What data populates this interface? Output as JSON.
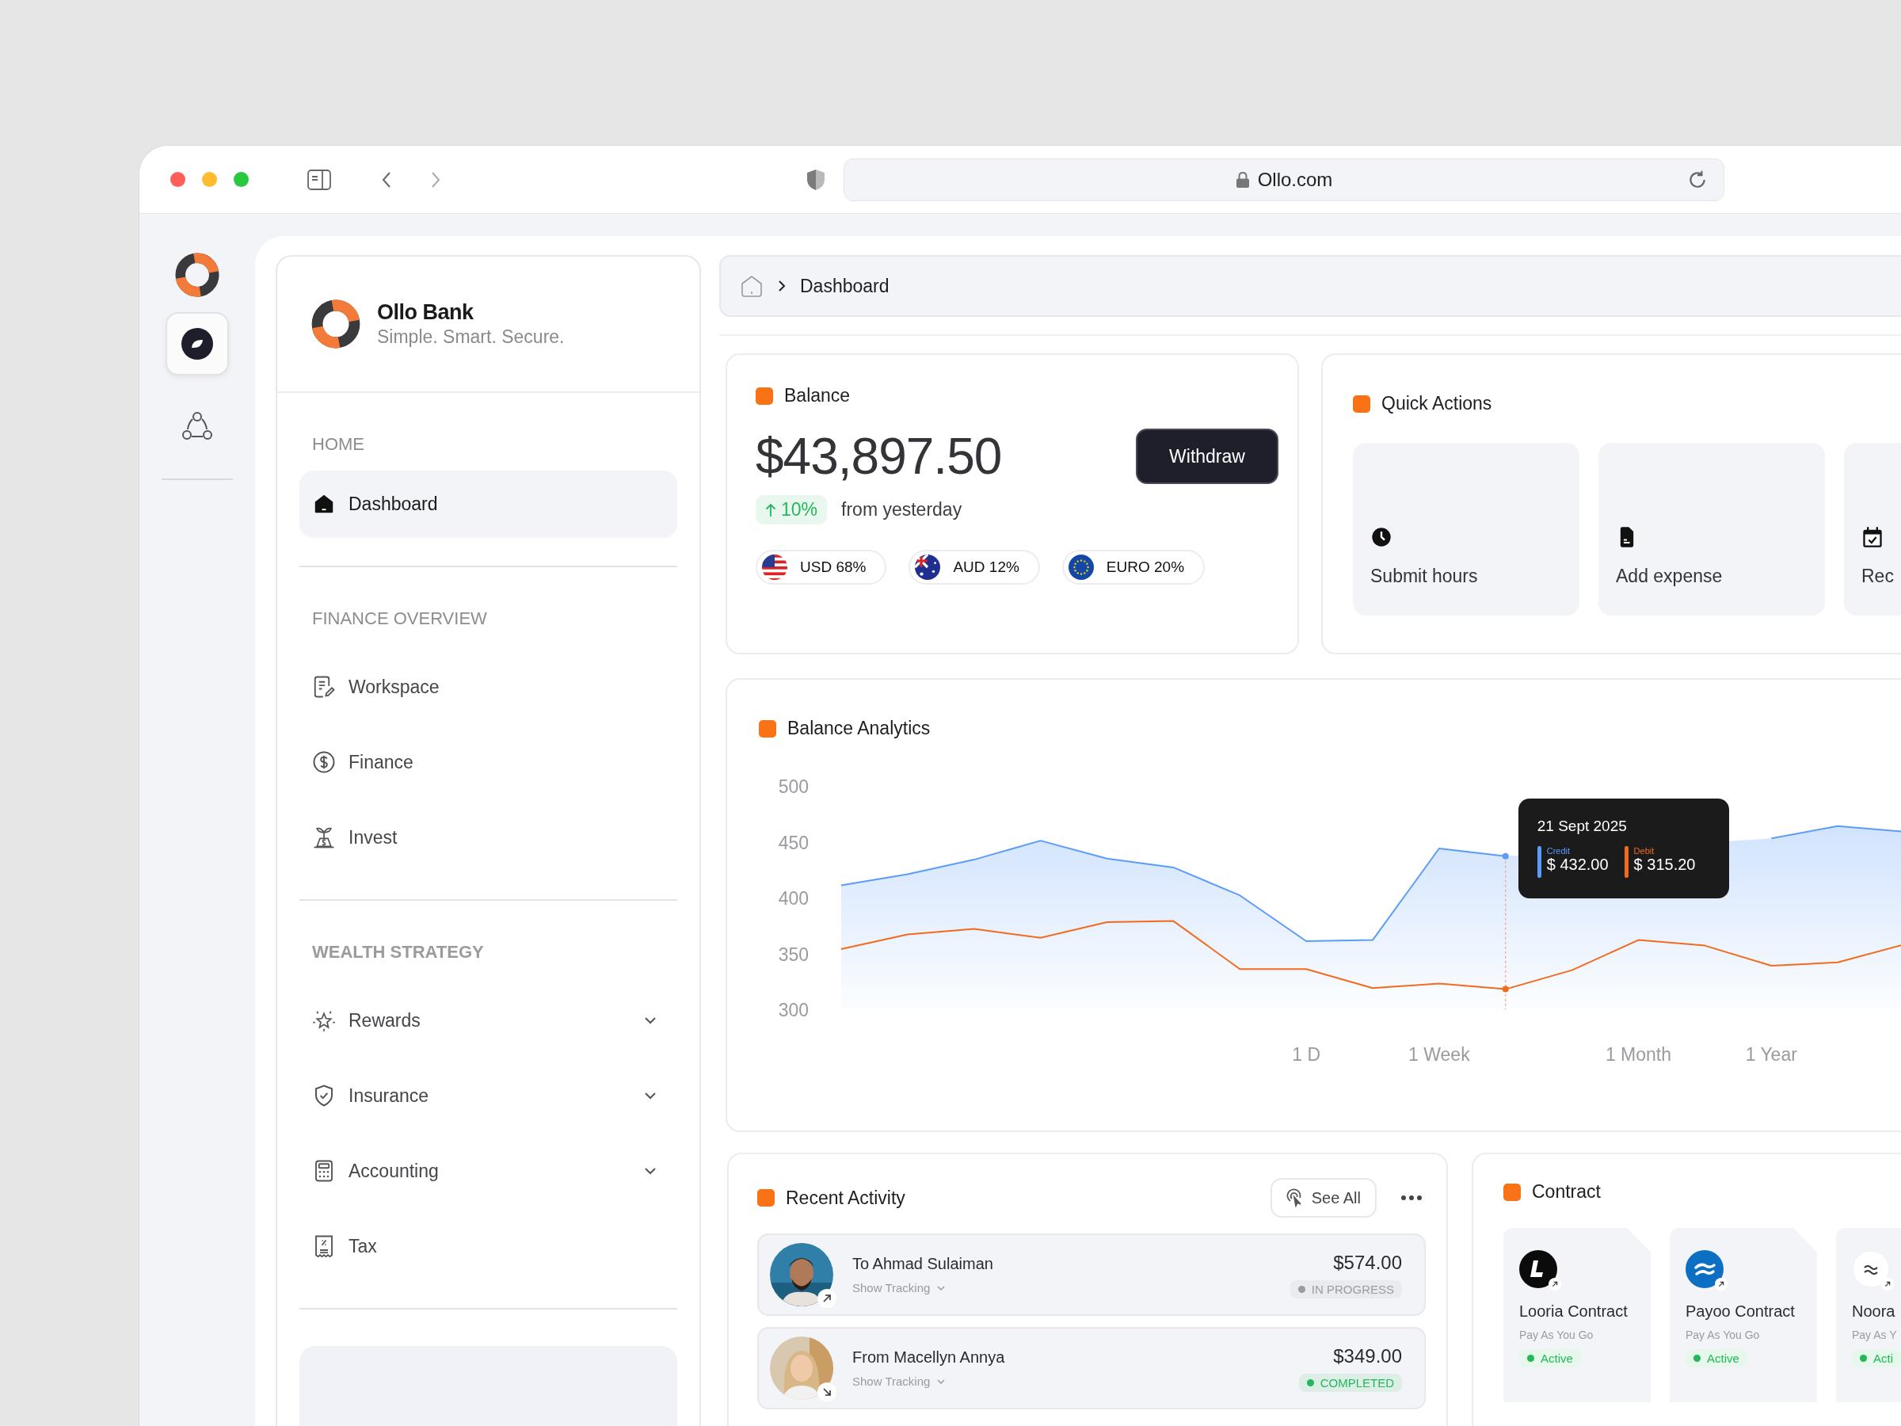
{
  "browser": {
    "url": "Ollo.com"
  },
  "rail": {
    "items": [
      {
        "selected": true
      },
      {
        "selected": false
      }
    ]
  },
  "sidebar": {
    "brand": {
      "name": "Ollo Bank",
      "tagline": "Simple. Smart. Secure."
    },
    "sections": [
      {
        "title": "HOME",
        "items": [
          {
            "label": "Dashboard",
            "selected": true,
            "expandable": false
          }
        ]
      },
      {
        "title": "FINANCE OVERVIEW",
        "items": [
          {
            "label": "Workspace",
            "selected": false,
            "expandable": false
          },
          {
            "label": "Finance",
            "selected": false,
            "expandable": false
          },
          {
            "label": "Invest",
            "selected": false,
            "expandable": false
          }
        ]
      },
      {
        "title": "WEALTH STRATEGY",
        "items": [
          {
            "label": "Rewards",
            "selected": false,
            "expandable": true
          },
          {
            "label": "Insurance",
            "selected": false,
            "expandable": true
          },
          {
            "label": "Accounting",
            "selected": false,
            "expandable": true
          },
          {
            "label": "Tax",
            "selected": false,
            "expandable": false
          }
        ]
      }
    ]
  },
  "breadcrumb": {
    "items": [
      "Dashboard"
    ]
  },
  "balance": {
    "title": "Balance",
    "amount": "$43,897.50",
    "action": "Withdraw",
    "change": {
      "value": "10%"
    },
    "change_note": "from yesterday",
    "currencies": [
      {
        "label": "USD 68%"
      },
      {
        "label": "AUD 12%"
      },
      {
        "label": "EURO 20%"
      }
    ]
  },
  "quick_actions": {
    "title": "Quick Actions",
    "items": [
      "Submit hours",
      "Add expense",
      "Rec"
    ]
  },
  "analytics": {
    "title": "Balance Analytics",
    "chart_data": {
      "type": "line",
      "categories": [
        null,
        null,
        null,
        null,
        null,
        null,
        null,
        "1 D",
        null,
        "1 Week",
        null,
        null,
        "1 Month",
        null,
        "1 Year",
        null,
        null
      ],
      "ylim": [
        300,
        500
      ],
      "yticks": [
        300,
        350,
        400,
        450,
        500
      ],
      "series": [
        {
          "name": "Credit",
          "type": "area",
          "color": "#5b9cf8",
          "values": [
            411,
            421,
            434,
            451,
            435,
            427,
            402,
            361,
            362,
            444,
            437,
            null,
            null,
            null,
            453,
            464,
            459
          ]
        },
        {
          "name": "Debit",
          "type": "line",
          "color": "#f26b1d",
          "values": [
            354,
            367,
            372,
            364,
            378,
            379,
            336,
            336,
            319,
            323,
            318,
            335,
            362,
            357,
            339,
            342,
            358
          ]
        }
      ]
    },
    "tooltip": {
      "date": "21 Sept 2025",
      "entries": [
        {
          "value": "$ 432.00"
        },
        {
          "value": "$ 315.20"
        }
      ]
    }
  },
  "recent_activity": {
    "title": "Recent Activity",
    "see_all": "See All",
    "items": [
      {
        "name": "To Ahmad Sulaiman",
        "tracking": "Show Tracking",
        "amount": "$574.00",
        "status": "IN PROGRESS",
        "color": "#9a9ca3"
      },
      {
        "name": "From Macellyn Annya",
        "tracking": "Show Tracking",
        "amount": "$349.00",
        "status": "COMPLETED",
        "color": "#22b85a"
      }
    ]
  },
  "contracts": {
    "title": "Contract",
    "items": [
      {
        "name": "Looria Contract",
        "plan": "Pay As You Go",
        "status": "Active"
      },
      {
        "name": "Payoo Contract",
        "plan": "Pay As You Go",
        "status": "Active"
      },
      {
        "name": "Noora",
        "plan": "Pay As Y",
        "status": "Acti"
      }
    ]
  }
}
